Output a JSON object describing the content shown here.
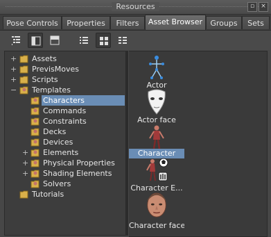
{
  "window": {
    "title": "Resources"
  },
  "tabs": [
    {
      "label": "Pose Controls",
      "active": false
    },
    {
      "label": "Properties",
      "active": false
    },
    {
      "label": "Filters",
      "active": false
    },
    {
      "label": "Asset Browser",
      "active": true
    },
    {
      "label": "Groups",
      "active": false
    },
    {
      "label": "Sets",
      "active": false
    }
  ],
  "toolbar": {
    "buttons": [
      {
        "icon": "tree-list-icon",
        "on": false
      },
      {
        "icon": "split-vertical-icon",
        "on": true
      },
      {
        "icon": "split-horizontal-icon",
        "on": false
      },
      {
        "icon": "list-view-icon",
        "on": false
      },
      {
        "icon": "icon-view-icon",
        "on": true
      },
      {
        "icon": "detail-view-icon",
        "on": false
      }
    ]
  },
  "tree": [
    {
      "label": "Assets",
      "icon": "folder-icon",
      "expander": "+",
      "depth": 0
    },
    {
      "label": "PrevisMoves",
      "icon": "folder-icon",
      "expander": "+",
      "depth": 0
    },
    {
      "label": "Scripts",
      "icon": "folder-icon",
      "expander": "+",
      "depth": 0
    },
    {
      "label": "Templates",
      "icon": "template-folder-icon",
      "expander": "−",
      "depth": 0
    },
    {
      "label": "Characters",
      "icon": "template-icon",
      "expander": "",
      "depth": 1,
      "selected": true
    },
    {
      "label": "Commands",
      "icon": "template-icon",
      "expander": "",
      "depth": 1
    },
    {
      "label": "Constraints",
      "icon": "template-icon",
      "expander": "",
      "depth": 1
    },
    {
      "label": "Decks",
      "icon": "template-icon",
      "expander": "",
      "depth": 1
    },
    {
      "label": "Devices",
      "icon": "template-icon",
      "expander": "",
      "depth": 1
    },
    {
      "label": "Elements",
      "icon": "template-icon",
      "expander": "+",
      "depth": 1
    },
    {
      "label": "Physical Properties",
      "icon": "template-icon",
      "expander": "+",
      "depth": 1
    },
    {
      "label": "Shading Elements",
      "icon": "template-icon",
      "expander": "+",
      "depth": 1
    },
    {
      "label": "Solvers",
      "icon": "template-icon",
      "expander": "",
      "depth": 1
    },
    {
      "label": "Tutorials",
      "icon": "folder-icon",
      "expander": "",
      "depth": 0
    }
  ],
  "assets": [
    {
      "label": "Actor",
      "icon": "actor-skeleton-icon"
    },
    {
      "label": "Actor face",
      "icon": "actor-face-mask-icon"
    },
    {
      "label": "Character",
      "icon": "character-figure-icon",
      "selected": true
    },
    {
      "label": "Character E...",
      "icon": "character-extension-icon"
    },
    {
      "label": "Character face",
      "icon": "character-face-icon"
    }
  ],
  "colors": {
    "selection": "#6a8db5",
    "background": "#474747",
    "pane": "#3d3d3d"
  }
}
